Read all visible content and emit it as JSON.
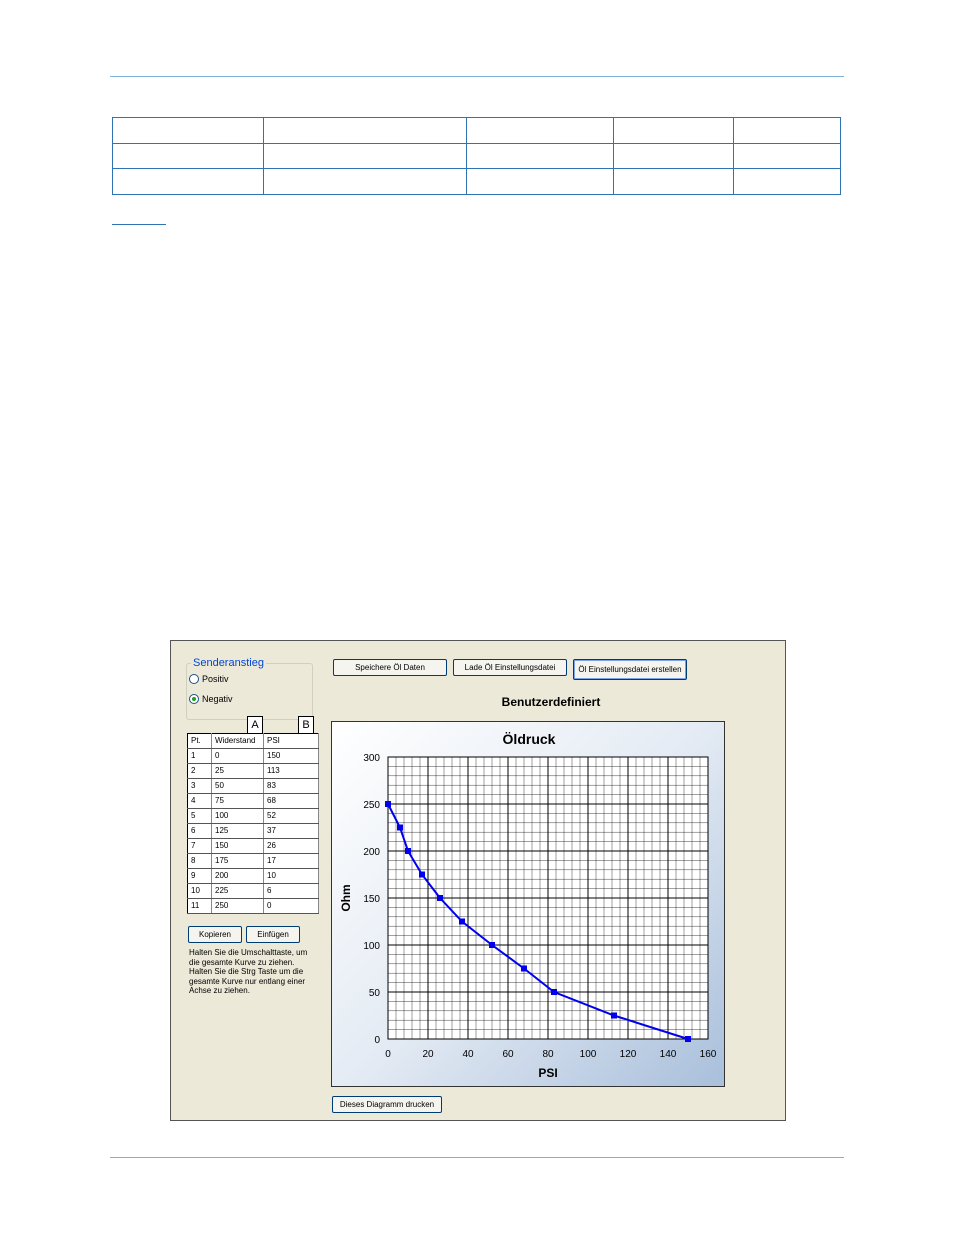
{
  "app": {
    "group_title": "Senderanstieg",
    "radio_positive": "Positiv",
    "radio_negative": "Negativ",
    "selected": "Negativ",
    "marker_a": "A",
    "marker_b": "B",
    "buttons": {
      "save": "Speichere Öl Daten",
      "load": "Lade Öl Einstellungsdatei",
      "create": "Öl Einstellungsdatei erstellen",
      "copy": "Kopieren",
      "paste": "Einfügen",
      "print": "Dieses Diagramm drucken"
    },
    "table": {
      "headers": [
        "Pt.",
        "Widerstand",
        "PSI"
      ],
      "rows": [
        [
          "1",
          "0",
          "150"
        ],
        [
          "2",
          "25",
          "113"
        ],
        [
          "3",
          "50",
          "83"
        ],
        [
          "4",
          "75",
          "68"
        ],
        [
          "5",
          "100",
          "52"
        ],
        [
          "6",
          "125",
          "37"
        ],
        [
          "7",
          "150",
          "26"
        ],
        [
          "8",
          "175",
          "17"
        ],
        [
          "9",
          "200",
          "10"
        ],
        [
          "10",
          "225",
          "6"
        ],
        [
          "11",
          "250",
          "0"
        ]
      ]
    },
    "help_text": "Halten Sie die Umschalttaste, um die gesamte Kurve zu ziehen.  Halten Sie die Strg Taste um die gesamte Kurve nur entlang einer Achse zu ziehen.",
    "chart_subtitle": "Benutzerdefiniert"
  },
  "chart_data": {
    "type": "line",
    "title": "Öldruck",
    "xlabel": "PSI",
    "ylabel": "Ohm",
    "xlim": [
      0,
      160
    ],
    "ylim": [
      0,
      300
    ],
    "xticks": [
      0,
      20,
      40,
      60,
      80,
      100,
      120,
      140,
      160
    ],
    "yticks": [
      0,
      50,
      100,
      150,
      200,
      250,
      300
    ],
    "grid": true,
    "color": "#0000ee",
    "points": [
      {
        "x": 0,
        "y": 250
      },
      {
        "x": 6,
        "y": 225
      },
      {
        "x": 10,
        "y": 200
      },
      {
        "x": 17,
        "y": 175
      },
      {
        "x": 26,
        "y": 150
      },
      {
        "x": 37,
        "y": 125
      },
      {
        "x": 52,
        "y": 100
      },
      {
        "x": 68,
        "y": 75
      },
      {
        "x": 83,
        "y": 50
      },
      {
        "x": 113,
        "y": 25
      },
      {
        "x": 150,
        "y": 0
      }
    ]
  }
}
